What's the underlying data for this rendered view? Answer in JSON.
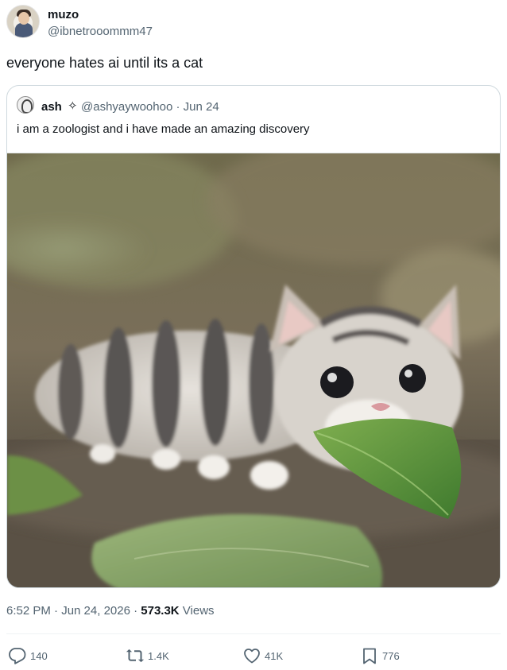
{
  "author": {
    "name": "muzo",
    "handle": "@ibnetrooommm47"
  },
  "tweet": {
    "text": "everyone hates ai until its a cat"
  },
  "quoted_tweet": {
    "name": "ash",
    "badge": "✧",
    "handle_date": "@ashyaywoohoo · Jun 24",
    "text": "i am a zoologist and i have made an amazing discovery",
    "media_description": "kitten-caterpillar holding a green leaf"
  },
  "meta": {
    "timestamp": "6:52 PM · Jun 24, 2026 · ",
    "views_count": "573.3K",
    "views_label": " Views"
  },
  "actions": {
    "replies": "140",
    "reposts": "1.4K",
    "likes": "41K",
    "bookmarks": "776"
  },
  "colors": {
    "text_primary": "#0f1419",
    "text_secondary": "#536471",
    "border": "#cfd9de"
  }
}
